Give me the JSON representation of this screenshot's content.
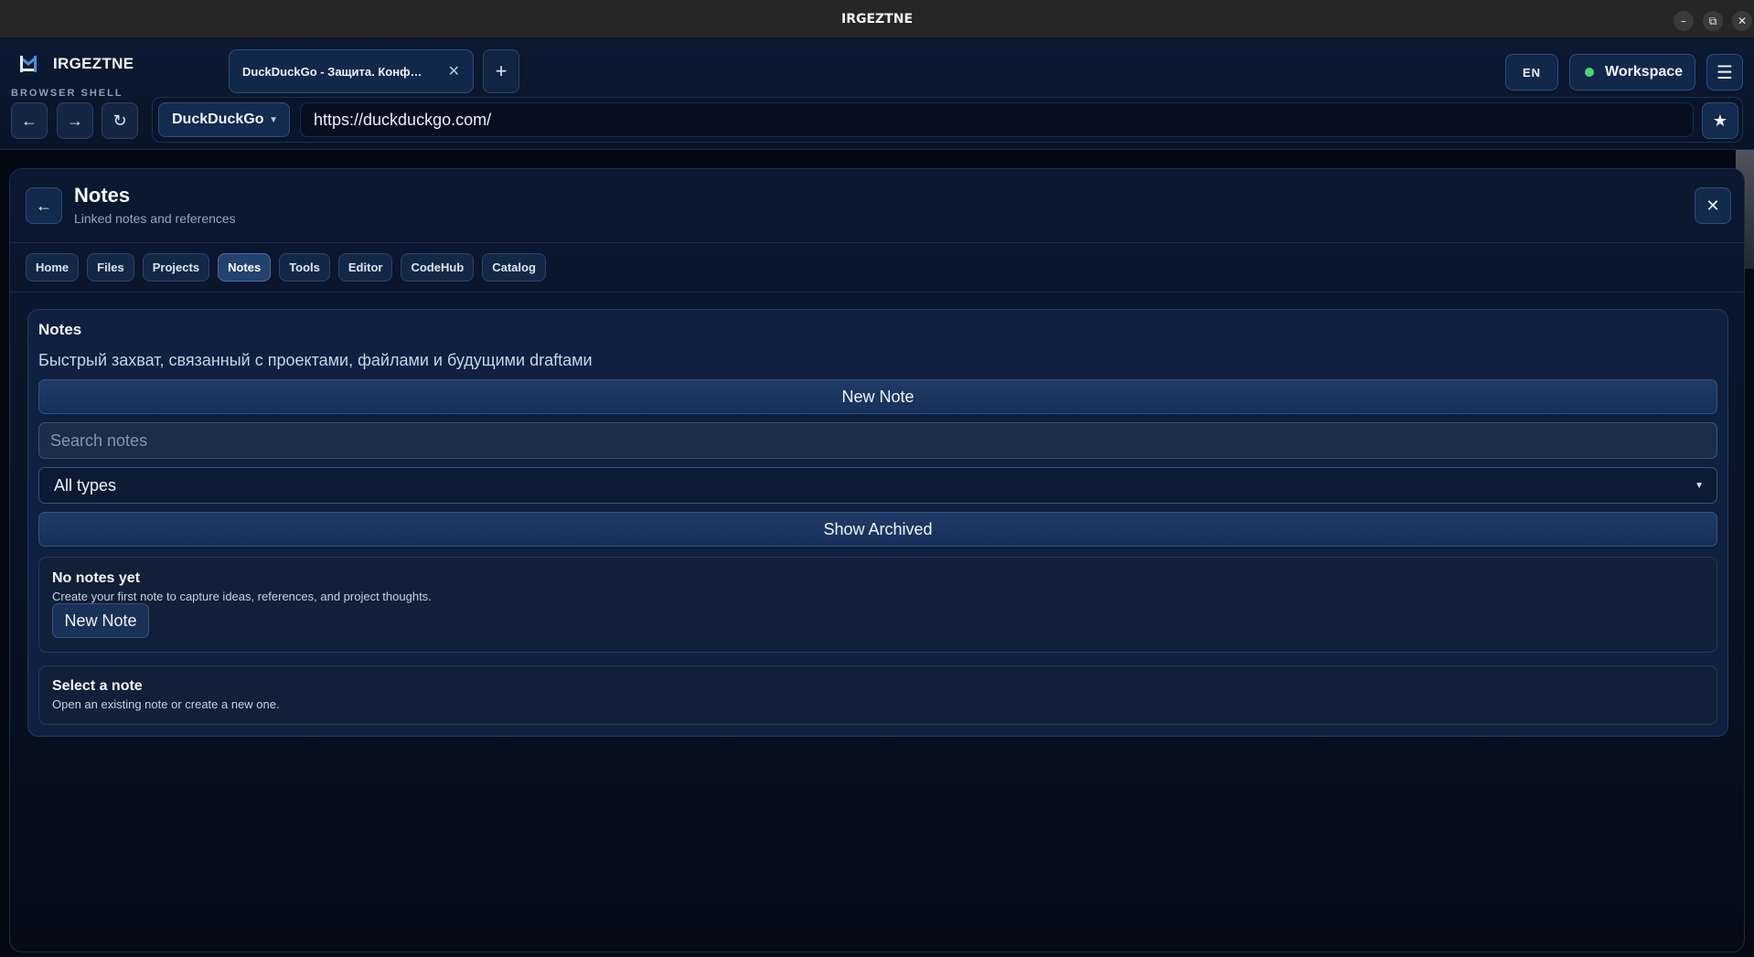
{
  "window": {
    "title": "IRGEZTNE",
    "minimize": "–",
    "restore": "⧉",
    "close": "✕"
  },
  "brand": {
    "name": "IRGEZTNE",
    "subtitle": "BROWSER SHELL"
  },
  "nav": {
    "back": "←",
    "forward": "→",
    "reload": "↻"
  },
  "tabs": [
    {
      "title": "DuckDuckGo - Защита. Конф…",
      "close": "✕"
    }
  ],
  "new_tab": "+",
  "language": "EN",
  "workspace": {
    "label": "Workspace",
    "status_color": "#4fd17a"
  },
  "menu_icon": "☰",
  "address": {
    "engine": "DuckDuckGo",
    "url": "https://duckduckgo.com/",
    "bookmark": "★"
  },
  "panel": {
    "back": "←",
    "title": "Notes",
    "subtitle": "Linked notes and references",
    "close": "✕",
    "navtabs": [
      "Home",
      "Files",
      "Projects",
      "Notes",
      "Tools",
      "Editor",
      "CodeHub",
      "Catalog"
    ],
    "active_tab": "Notes"
  },
  "notes": {
    "heading": "Notes",
    "description": "Быстрый захват, связанный с проектами, файлами и будущими draftами",
    "new_note_label": "New Note",
    "search_placeholder": "Search notes",
    "type_filter": "All types",
    "show_archived_label": "Show Archived",
    "empty": {
      "title": "No notes yet",
      "text": "Create your first note to capture ideas, references, and project thoughts.",
      "button": "New Note"
    },
    "select": {
      "title": "Select a note",
      "text": "Open an existing note or create a new one."
    }
  }
}
